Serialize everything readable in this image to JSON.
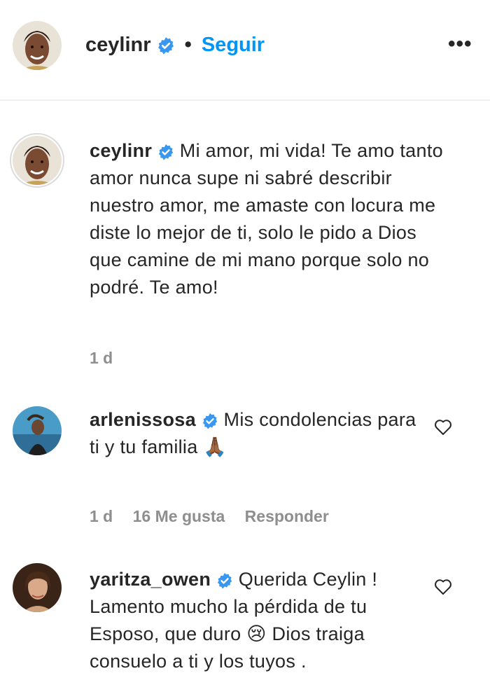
{
  "header": {
    "username": "ceylinr",
    "separator": "•",
    "follow_label": "Seguir",
    "more_label": "•••"
  },
  "caption": {
    "username": "ceylinr",
    "text": "Mi amor, mi vida! Te amo tanto amor nunca supe ni sabré describir nuestro amor, me amaste con locura me diste lo mejor de ti, solo le pido a Dios que camine de mi mano porque solo no podré. Te amo!",
    "time": "1 d"
  },
  "comments": [
    {
      "username": "arlenissosa",
      "text": "Mis condolencias para ti y tu familia",
      "emoji": "🙏🏾",
      "time": "1 d",
      "likes": "16 Me gusta",
      "reply_label": "Responder"
    },
    {
      "username": "yaritza_owen",
      "text": "Querida Ceylin ! Lamento mucho la pérdida de tu Esposo, que duro",
      "emoji": "😢",
      "text_after": "Dios traiga consuelo a ti y los tuyos ."
    }
  ],
  "colors": {
    "follow": "#0095f6",
    "verified": "#3897f0",
    "meta": "#8e8e8e"
  },
  "icons": {
    "verified": "verified-badge-icon",
    "heart": "heart-outline-icon",
    "more": "more-options-icon"
  }
}
